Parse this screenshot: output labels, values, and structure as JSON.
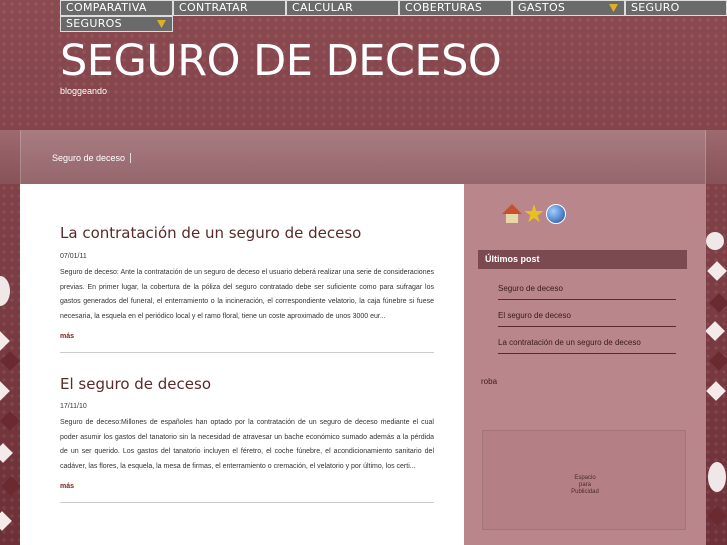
{
  "nav": {
    "row1": [
      {
        "label": "COMPARATIVA",
        "dropdown": false
      },
      {
        "label": "CONTRATAR",
        "dropdown": false
      },
      {
        "label": "CALCULAR",
        "dropdown": false
      },
      {
        "label": "COBERTURAS",
        "dropdown": false
      },
      {
        "label": "GASTOS",
        "dropdown": true
      },
      {
        "label": "SEGURO",
        "dropdown": false
      }
    ],
    "row2": [
      {
        "label": "SEGUROS",
        "dropdown": true
      }
    ]
  },
  "header": {
    "title": "SEGURO DE DECESO",
    "description": "bloggeando"
  },
  "breadcrumb": "Seguro de deceso",
  "posts": [
    {
      "title": "La contratación de un seguro de deceso",
      "date": "07/01/11",
      "body": "Seguro de deceso: Ante la contratación de un seguro de deceso el usuario deberá realizar una serie de consideraciones previas. En primer lugar, la cobertura de la póliza del seguro contratado debe ser suficiente como para sufragar los gastos generados del funeral, el enterramiento o la incineración, el correspondiente velatorio, la caja fúnebre si fuese necesaria, la esquela en el periódico local y el ramo floral, tiene un coste aproximado de unos 3000 eur...",
      "more": "más"
    },
    {
      "title": "El seguro de deceso",
      "date": "17/11/10",
      "body": "Seguro de deceso:Millones de españoles han optado por la contratación de un seguro de deceso mediante el cual poder asumir los gastos del tanatorio sin la necesidad de atravesar un bache económico sumado además a la pérdida de un ser querido. Los gastos del tanatorio incluyen el féretro, el coche fúnebre, el acondicionamiento sanitario del cadáver, las flores, la esquela, la mesa de firmas, el enterramiento o cremación, el velatorio y por último, los certi...",
      "more": "más"
    }
  ],
  "sidebar": {
    "icons": [
      "home-icon",
      "add-favorite-star-icon",
      "globe-icon"
    ],
    "widget_title": "Últimos post",
    "links": [
      "Seguro de deceso",
      "El seguro de deceso",
      "La contratación de un seguro de deceso"
    ],
    "roba": "roba",
    "ad_text": [
      "Espacio",
      "para",
      "Publicidad"
    ]
  },
  "colors": {
    "header_bg": "#7a3a40",
    "nav_bg": "#6a6a6a",
    "dropdown_arrow": "#e0b020",
    "sidebar_bg": "#b9868c",
    "widget_title_bg": "#7a4a50",
    "post_title": "#5a2a2a"
  }
}
